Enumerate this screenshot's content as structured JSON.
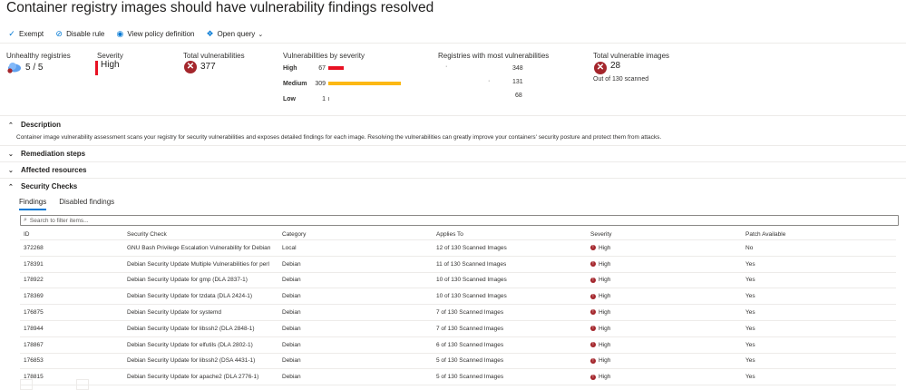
{
  "title": "Container registry images should have vulnerability findings resolved",
  "more_label": "···",
  "toolbar": [
    {
      "icon": "✓",
      "name": "exempt",
      "label": "Exempt"
    },
    {
      "icon": "⊘",
      "name": "disable-rule",
      "label": "Disable rule"
    },
    {
      "icon": "◉",
      "name": "view-policy",
      "label": "View policy definition"
    },
    {
      "icon": "❖",
      "name": "open-query",
      "label": "Open query"
    }
  ],
  "open_query_chevron": "⌄",
  "kpis": {
    "unhealthy_label": "Unhealthy registries",
    "unhealthy_value": "5 / 5",
    "severity_label": "Severity",
    "severity_value": "High",
    "total_vuln_label": "Total vulnerabilities",
    "total_vuln_value": "377",
    "by_severity_label": "Vulnerabilities by severity",
    "by_severity": [
      {
        "label": "High",
        "count": "67",
        "value": 67
      },
      {
        "label": "Medium",
        "count": "309",
        "value": 309
      },
      {
        "label": "Low",
        "count": "1",
        "value": 1
      }
    ],
    "registries_label": "Registries with most vulnerabilities",
    "registries": [
      "348",
      "131",
      "68"
    ],
    "vuln_images_label": "Total vulnerable images",
    "vuln_images_value": "28",
    "vuln_images_sub": "Out of 130 scanned"
  },
  "colors": {
    "high": "#e81123",
    "medium": "#fcb814",
    "low": "#8a8886",
    "accent": "#0078d4"
  },
  "sections": {
    "description": "Description",
    "description_text": "Container image vulnerability assessment scans your registry for security vulnerabilities and exposes detailed findings for each image. Resolving the vulnerabilities can greatly improve your containers' security posture and protect them from attacks.",
    "remediation": "Remediation steps",
    "affected": "Affected resources",
    "security_checks": "Security Checks"
  },
  "tabs": [
    "Findings",
    "Disabled findings"
  ],
  "filter_placeholder": "Search to filter items...",
  "table": {
    "headers": [
      "ID",
      "Security Check",
      "Category",
      "Applies To",
      "Severity",
      "Patch Available"
    ],
    "rows": [
      [
        "372268",
        "GNU Bash Privilege Escalation Vulnerability for Debian",
        "Local",
        "12 of 130 Scanned Images",
        "High",
        "No"
      ],
      [
        "178391",
        "Debian Security Update Multiple Vulnerabilities for perl",
        "Debian",
        "11 of 130 Scanned Images",
        "High",
        "Yes"
      ],
      [
        "178922",
        "Debian Security Update for gmp (DLA 2837-1)",
        "Debian",
        "10 of 130 Scanned Images",
        "High",
        "Yes"
      ],
      [
        "178369",
        "Debian Security Update for tzdata (DLA 2424-1)",
        "Debian",
        "10 of 130 Scanned Images",
        "High",
        "Yes"
      ],
      [
        "176875",
        "Debian Security Update for systemd",
        "Debian",
        "7 of 130 Scanned Images",
        "High",
        "Yes"
      ],
      [
        "178944",
        "Debian Security Update for libssh2 (DLA 2848-1)",
        "Debian",
        "7 of 130 Scanned Images",
        "High",
        "Yes"
      ],
      [
        "178867",
        "Debian Security Update for elfutils (DLA 2802-1)",
        "Debian",
        "6 of 130 Scanned Images",
        "High",
        "Yes"
      ],
      [
        "176853",
        "Debian Security Update for libssh2 (DSA 4431-1)",
        "Debian",
        "5 of 130 Scanned Images",
        "High",
        "Yes"
      ],
      [
        "178815",
        "Debian Security Update for apache2 (DLA 2776-1)",
        "Debian",
        "5 of 130 Scanned Images",
        "High",
        "Yes"
      ]
    ]
  }
}
